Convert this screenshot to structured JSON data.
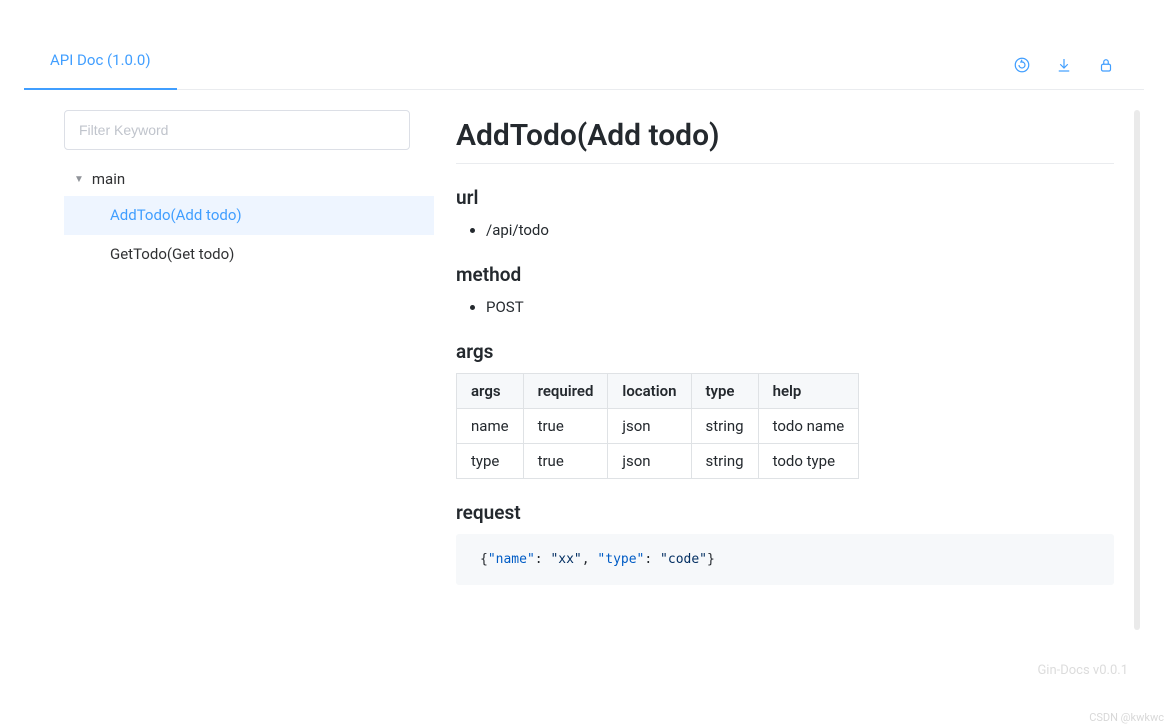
{
  "header": {
    "tab_label": "API Doc (1.0.0)"
  },
  "sidebar": {
    "filter_placeholder": "Filter Keyword",
    "tree": {
      "root": "main",
      "items": [
        {
          "label": "AddTodo(Add todo)",
          "selected": true
        },
        {
          "label": "GetTodo(Get todo)",
          "selected": false
        }
      ]
    }
  },
  "doc": {
    "title": "AddTodo(Add todo)",
    "sections": {
      "url": {
        "heading": "url",
        "value": "/api/todo"
      },
      "method": {
        "heading": "method",
        "value": "POST"
      },
      "args": {
        "heading": "args",
        "columns": [
          "args",
          "required",
          "location",
          "type",
          "help"
        ],
        "rows": [
          {
            "args": "name",
            "required": "true",
            "location": "json",
            "type": "string",
            "help": "todo name"
          },
          {
            "args": "type",
            "required": "true",
            "location": "json",
            "type": "string",
            "help": "todo type"
          }
        ]
      },
      "request": {
        "heading": "request",
        "body": "{\"name\": \"xx\", \"type\": \"code\"}",
        "tokens": [
          {
            "t": "{",
            "c": "pn"
          },
          {
            "t": "\"name\"",
            "c": "key"
          },
          {
            "t": ": ",
            "c": "pn"
          },
          {
            "t": "\"xx\"",
            "c": "str"
          },
          {
            "t": ", ",
            "c": "pn"
          },
          {
            "t": "\"type\"",
            "c": "key"
          },
          {
            "t": ": ",
            "c": "pn"
          },
          {
            "t": "\"code\"",
            "c": "str"
          },
          {
            "t": "}",
            "c": "pn"
          }
        ]
      }
    }
  },
  "footer": {
    "gen": "Gin-Docs v0.0.1",
    "watermark": "CSDN @kwkwc"
  }
}
